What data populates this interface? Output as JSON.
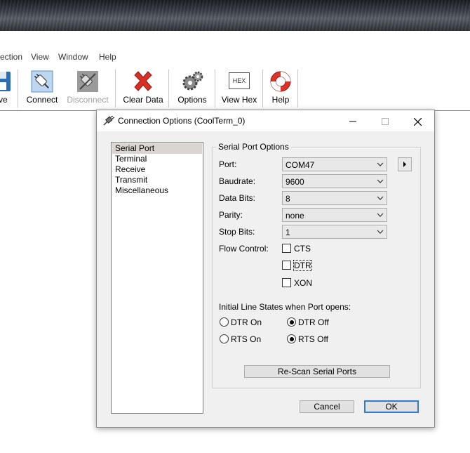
{
  "menu": [
    "ection",
    "View",
    "Window",
    "Help"
  ],
  "toolbar": {
    "save_label": "ve",
    "connect_label": "Connect",
    "disconnect_label": "Disconnect",
    "clear_label": "Clear Data",
    "options_label": "Options",
    "hex_icon_text": "HEX",
    "viewhex_label": "View Hex",
    "help_label": "Help"
  },
  "dialog": {
    "title": "Connection Options (CoolTerm_0)",
    "sidebar": [
      "Serial Port",
      "Terminal",
      "Receive",
      "Transmit",
      "Miscellaneous"
    ],
    "group_title": "Serial Port Options",
    "fields": {
      "port_label": "Port:",
      "port_value": "COM47",
      "baud_label": "Baudrate:",
      "baud_value": "9600",
      "databits_label": "Data Bits:",
      "databits_value": "8",
      "parity_label": "Parity:",
      "parity_value": "none",
      "stopbits_label": "Stop Bits:",
      "stopbits_value": "1",
      "flow_label": "Flow Control:"
    },
    "flow": {
      "cts": "CTS",
      "dtr": "DTR",
      "xon": "XON"
    },
    "line_states_title": "Initial Line States when Port opens:",
    "line_states": {
      "dtr_on": "DTR On",
      "dtr_off": "DTR Off",
      "rts_on": "RTS On",
      "rts_off": "RTS Off"
    },
    "rescan_label": "Re-Scan Serial Ports",
    "cancel_label": "Cancel",
    "ok_label": "OK"
  },
  "colors": {
    "ok_border": "#2f7bd6",
    "clear_icon": "#d93025",
    "help_ring": "#e0322b"
  }
}
